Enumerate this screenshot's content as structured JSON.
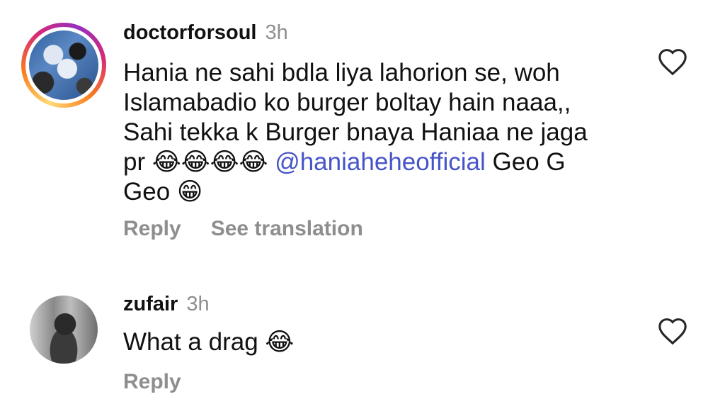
{
  "comments": [
    {
      "username": "doctorforsoul",
      "time": "3h",
      "text_lines": [
        "Hania ne sahi bdla liya lahorion se, woh",
        "Islamabadio ko burger boltay hain naaa,,",
        "Sahi tekka k Burger bnaya Haniaa ne jaga"
      ],
      "line4_prefix": "pr ",
      "line4_emojis": "😂😂😂😂",
      "mention": "@haniaheheofficial",
      "line4_suffix": " Geo G",
      "line5_text": "Geo ",
      "line5_emoji": "😁",
      "reply_label": "Reply",
      "translate_label": "See translation"
    },
    {
      "username": "zufair",
      "time": "3h",
      "text": "What a drag ",
      "emoji": "😂",
      "reply_label": "Reply"
    }
  ],
  "icons": {
    "like": "heart-icon",
    "mention_prefix": "threads-icon"
  },
  "colors": {
    "mention": "#4754c7",
    "secondary_text": "#8e8e8e",
    "story_ring": "#d62976"
  }
}
